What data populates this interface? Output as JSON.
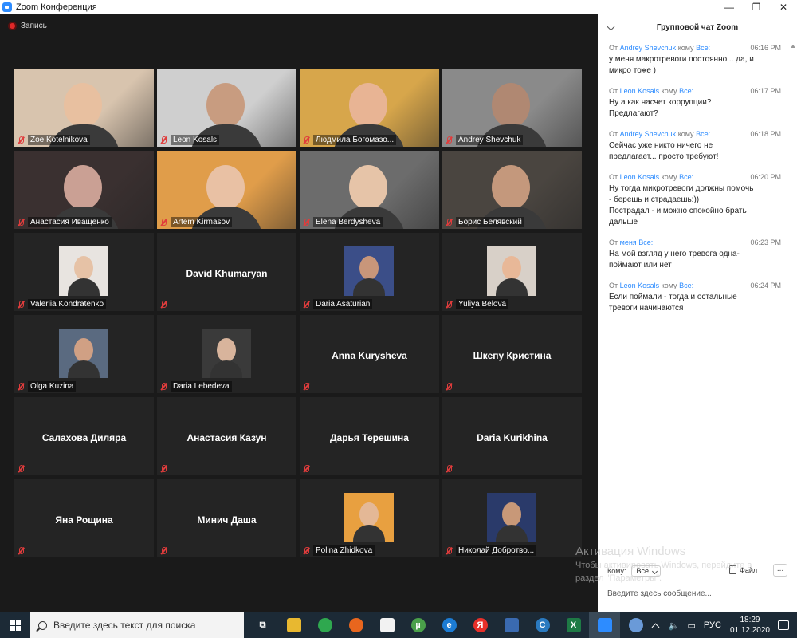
{
  "window": {
    "title": "Zoom Конференция",
    "minimize_glyph": "—",
    "restore_glyph": "❐",
    "close_glyph": "✕"
  },
  "recording": {
    "label": "Запись"
  },
  "participants": [
    {
      "name": "Zoe Kotelnikova",
      "kind": "video",
      "bg": "#d8c4ae",
      "face": "#e8c0a0"
    },
    {
      "name": "Leon Kosals",
      "kind": "video",
      "bg": "#cfcfcf",
      "face": "#c89c80"
    },
    {
      "name": "Людмила Богомазо...",
      "kind": "video",
      "bg": "#d7a64b",
      "face": "#e8b494"
    },
    {
      "name": "Andrey Shevchuk",
      "kind": "video",
      "bg": "#8a8a8a",
      "face": "#b08872"
    },
    {
      "name": "Анастасия Иващенко",
      "kind": "video",
      "bg": "#3a3030",
      "face": "#caa094"
    },
    {
      "name": "Artem Kirmasov",
      "kind": "video",
      "bg": "#e09d4a",
      "face": "#e9c1a4",
      "active": true
    },
    {
      "name": "Elena Berdysheva",
      "kind": "video",
      "bg": "#6c6c6c",
      "face": "#e6c4a8"
    },
    {
      "name": "Борис Белявский",
      "kind": "video",
      "bg": "#4a4540",
      "face": "#c4987c"
    },
    {
      "name": "Valeriia Kondratenko",
      "kind": "photo",
      "bg": "#e8e4e0",
      "face": "#e6c2a6"
    },
    {
      "name": "David Khumaryan",
      "kind": "name"
    },
    {
      "name": "Daria Asaturian",
      "kind": "photo",
      "bg": "#3b4e88",
      "face": "#c8967a"
    },
    {
      "name": "Yuliya Belova",
      "kind": "photo",
      "bg": "#d8d0c8",
      "face": "#e8b898"
    },
    {
      "name": "Olga Kuzina",
      "kind": "photo",
      "bg": "#5a6a80",
      "face": "#d0a084"
    },
    {
      "name": "Daria Lebedeva",
      "kind": "photo",
      "bg": "#3a3a3a",
      "face": "#d8b49c"
    },
    {
      "name": "Anna Kurysheva",
      "kind": "name"
    },
    {
      "name": "Шкепу Кристина",
      "kind": "name"
    },
    {
      "name": "Салахова Диляра",
      "kind": "name"
    },
    {
      "name": "Анастасия Казун",
      "kind": "name"
    },
    {
      "name": "Дарья Терешина",
      "kind": "name"
    },
    {
      "name": "Daria Kurikhina",
      "kind": "name"
    },
    {
      "name": "Яна Рощина",
      "kind": "name"
    },
    {
      "name": "Минич Даша",
      "kind": "name"
    },
    {
      "name": "Polina Zhidkova",
      "kind": "photo",
      "bg": "#e8a040",
      "face": "#e4b896"
    },
    {
      "name": "Николай Добротво...",
      "kind": "photo",
      "bg": "#2a3a6a",
      "face": "#c89878"
    }
  ],
  "chat": {
    "title": "Групповой чат Zoom",
    "messages": [
      {
        "from_prefix": "От",
        "sender": "Andrey Shevchuk",
        "to_word": "кому",
        "recipient": "Все:",
        "time": "06:16 PM",
        "text": "у меня макротревоги постоянно... да, и\nмикро тоже )"
      },
      {
        "from_prefix": "От",
        "sender": "Leon Kosals",
        "to_word": "кому",
        "recipient": "Все:",
        "time": "06:17 PM",
        "text": "Ну а как насчет коррупции?\nПредлагают?"
      },
      {
        "from_prefix": "От",
        "sender": "Andrey Shevchuk",
        "to_word": "кому",
        "recipient": "Все:",
        "time": "06:18 PM",
        "text": "Сейчас уже никто ничего не\nпредлагает... просто требуют!"
      },
      {
        "from_prefix": "От",
        "sender": "Leon Kosals",
        "to_word": "кому",
        "recipient": "Все:",
        "time": "06:20 PM",
        "text": "Ну тогда микротревоги должны помочь\n- берешь и страдаешь:))\nПострадал - и можно спокойно брать\nдальше"
      },
      {
        "from_prefix": "От",
        "sender": "меня",
        "to_word": "",
        "recipient": "Все:",
        "time": "06:23 PM",
        "text": "На мой взгляд у него тревога одна-\nпоймают или нет"
      },
      {
        "from_prefix": "От",
        "sender": "Leon Kosals",
        "to_word": "кому",
        "recipient": "Все:",
        "time": "06:24 PM",
        "text": "Если поймали - тогда и остальные\nтревоги начинаются"
      }
    ],
    "to_label": "Кому:",
    "to_value": "Все",
    "file_label": "Файл",
    "more_label": "...",
    "input_placeholder": "Введите здесь сообщение..."
  },
  "watermark": {
    "line1": "Активация Windows",
    "line2": "Чтобы активировать Windows, перейдите в",
    "line3": "раздел \"Параметры\"."
  },
  "taskbar": {
    "search_placeholder": "Введите здесь текст для поиска",
    "apps": [
      {
        "name": "task-view",
        "glyph": "⧉",
        "color": "#1c2a36"
      },
      {
        "name": "file-explorer",
        "glyph": "",
        "color": "#e8b830"
      },
      {
        "name": "chrome",
        "glyph": "",
        "color": "#2fa84f",
        "round": true
      },
      {
        "name": "firefox",
        "glyph": "",
        "color": "#e8661e",
        "round": true
      },
      {
        "name": "notepad",
        "glyph": "",
        "color": "#f2f2f2"
      },
      {
        "name": "utorrent",
        "glyph": "µ",
        "color": "#4aa04a",
        "round": true
      },
      {
        "name": "edge",
        "glyph": "e",
        "color": "#1c7cd4",
        "round": true
      },
      {
        "name": "yandex",
        "glyph": "Я",
        "color": "#e8302a",
        "round": true
      },
      {
        "name": "network-monitor",
        "glyph": "",
        "color": "#3a6ab0"
      },
      {
        "name": "ccleaner",
        "glyph": "C",
        "color": "#2a7ac0",
        "round": true
      },
      {
        "name": "excel",
        "glyph": "X",
        "color": "#1e7a45"
      },
      {
        "name": "zoom",
        "glyph": "",
        "color": "#2d8cff",
        "active": true
      },
      {
        "name": "paint",
        "glyph": "",
        "color": "#6a9ad8",
        "round": true
      }
    ],
    "tray": {
      "language": "РУС",
      "time": "18:29",
      "date": "01.12.2020"
    }
  }
}
